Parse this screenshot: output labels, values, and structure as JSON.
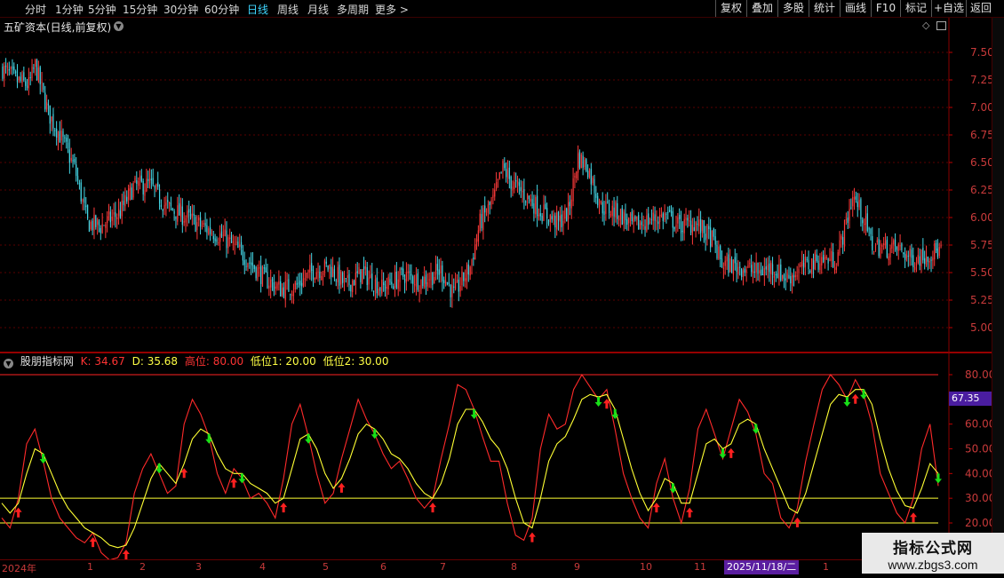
{
  "toolbar": {
    "timeframes": [
      {
        "label": "分时",
        "active": false
      },
      {
        "label": "1分钟",
        "active": false
      },
      {
        "label": "5分钟",
        "active": false
      },
      {
        "label": "15分钟",
        "active": false
      },
      {
        "label": "30分钟",
        "active": false
      },
      {
        "label": "60分钟",
        "active": false
      },
      {
        "label": "日线",
        "active": true
      },
      {
        "label": "周线",
        "active": false
      },
      {
        "label": "月线",
        "active": false
      },
      {
        "label": "多周期",
        "active": false
      },
      {
        "label": "更多",
        "active": false
      }
    ],
    "more_arrow": ">",
    "right_buttons": [
      "复权",
      "叠加",
      "多股",
      "统计",
      "画线",
      "F10",
      "标记",
      "+自选",
      "返回"
    ]
  },
  "stock": {
    "title": "五矿资本(日线,前复权)",
    "dropdown_icon": "chevron-down-icon"
  },
  "price_axis": {
    "ticks": [
      "7.50",
      "7.25",
      "7.00",
      "6.75",
      "6.50",
      "6.25",
      "6.00",
      "5.75",
      "5.50",
      "5.25",
      "5.00"
    ]
  },
  "indicator": {
    "name": "股朋指标网",
    "k_label": "K: 34.67",
    "d_label": "D: 35.68",
    "high_label": "高位: 80.00",
    "low1_label": "低位1: 20.00",
    "low2_label": "低位2: 30.00",
    "current_value": "67.35",
    "axis_ticks": [
      "80.00",
      "70.00",
      "60.00",
      "50.00",
      "40.00",
      "30.00",
      "20.00"
    ]
  },
  "date_axis": {
    "labels": [
      "2024年",
      "1",
      "2",
      "3",
      "4",
      "5",
      "6",
      "7",
      "8",
      "9",
      "10",
      "11",
      "1"
    ],
    "cursor_date": "2025/11/18/二"
  },
  "watermark": {
    "line1": "指标公式网",
    "line2": "www.zbgs3.com"
  },
  "colors": {
    "up": "#ff3b3b",
    "down": "#44d7e6",
    "k_line": "#ff2a2a",
    "d_line": "#ffff33",
    "ref_high": "#ff2222",
    "ref_low": "#ffff33",
    "grid": "#5a0000",
    "arrow_buy": "#ff2020",
    "arrow_sell": "#18e018"
  },
  "chart_data": [
    {
      "type": "candlestick",
      "title": "五矿资本(日线,前复权)",
      "yticks": [
        7.5,
        7.25,
        7.0,
        6.75,
        6.5,
        6.25,
        6.0,
        5.75,
        5.5,
        5.25,
        5.0
      ],
      "ylim": [
        4.95,
        7.65
      ],
      "anchors": [
        [
          0,
          7.35
        ],
        [
          8,
          7.25
        ],
        [
          16,
          7.2
        ],
        [
          20,
          7.38
        ],
        [
          28,
          6.95
        ],
        [
          36,
          6.72
        ],
        [
          44,
          6.45
        ],
        [
          52,
          5.95
        ],
        [
          60,
          5.92
        ],
        [
          72,
          6.05
        ],
        [
          80,
          6.28
        ],
        [
          90,
          6.3
        ],
        [
          100,
          6.1
        ],
        [
          110,
          6.02
        ],
        [
          122,
          5.92
        ],
        [
          135,
          5.82
        ],
        [
          148,
          5.65
        ],
        [
          160,
          5.45
        ],
        [
          170,
          5.35
        ],
        [
          180,
          5.38
        ],
        [
          190,
          5.52
        ],
        [
          200,
          5.55
        ],
        [
          210,
          5.38
        ],
        [
          220,
          5.5
        ],
        [
          232,
          5.36
        ],
        [
          246,
          5.48
        ],
        [
          256,
          5.42
        ],
        [
          268,
          5.52
        ],
        [
          276,
          5.3
        ],
        [
          286,
          5.55
        ],
        [
          292,
          5.95
        ],
        [
          300,
          6.15
        ],
        [
          306,
          6.45
        ],
        [
          312,
          6.3
        ],
        [
          320,
          6.2
        ],
        [
          330,
          6.05
        ],
        [
          340,
          5.95
        ],
        [
          346,
          6.05
        ],
        [
          352,
          6.55
        ],
        [
          358,
          6.45
        ],
        [
          366,
          6.1
        ],
        [
          376,
          6.05
        ],
        [
          386,
          5.92
        ],
        [
          396,
          5.98
        ],
        [
          406,
          6.02
        ],
        [
          414,
          5.92
        ],
        [
          424,
          5.95
        ],
        [
          434,
          5.8
        ],
        [
          440,
          5.58
        ],
        [
          452,
          5.55
        ],
        [
          462,
          5.5
        ],
        [
          470,
          5.55
        ],
        [
          480,
          5.45
        ],
        [
          490,
          5.55
        ],
        [
          500,
          5.62
        ],
        [
          510,
          5.62
        ],
        [
          516,
          5.95
        ],
        [
          520,
          6.2
        ],
        [
          526,
          6.02
        ],
        [
          532,
          5.75
        ],
        [
          540,
          5.72
        ],
        [
          548,
          5.72
        ],
        [
          556,
          5.62
        ],
        [
          564,
          5.66
        ],
        [
          572,
          5.7
        ]
      ],
      "note_units": "price"
    },
    {
      "type": "line",
      "series": [
        {
          "name": "K",
          "values": [
            22,
            18,
            30,
            52,
            58,
            45,
            30,
            22,
            18,
            14,
            12,
            16,
            8,
            5,
            6,
            12,
            32,
            42,
            48,
            40,
            32,
            35,
            60,
            70,
            64,
            55,
            40,
            32,
            42,
            38,
            30,
            32,
            28,
            22,
            38,
            60,
            68,
            55,
            40,
            28,
            32,
            46,
            58,
            70,
            62,
            56,
            48,
            42,
            45,
            38,
            30,
            26,
            30,
            46,
            60,
            76,
            74,
            66,
            55,
            45,
            45,
            28,
            15,
            13,
            22,
            50,
            64,
            58,
            60,
            74,
            80,
            75,
            70,
            74,
            58,
            40,
            30,
            22,
            18,
            36,
            46,
            30,
            20,
            34,
            58,
            66,
            56,
            46,
            58,
            70,
            65,
            56,
            40,
            36,
            22,
            18,
            26,
            45,
            60,
            74,
            80,
            76,
            70,
            78,
            72,
            60,
            40,
            32,
            24,
            20,
            30,
            50,
            60,
            35
          ]
        },
        {
          "name": "D",
          "values": [
            28,
            24,
            28,
            40,
            50,
            48,
            40,
            32,
            26,
            22,
            18,
            16,
            14,
            11,
            10,
            11,
            18,
            28,
            38,
            44,
            40,
            36,
            44,
            54,
            58,
            56,
            48,
            42,
            40,
            40,
            36,
            34,
            32,
            28,
            30,
            42,
            54,
            56,
            50,
            40,
            34,
            38,
            46,
            56,
            60,
            58,
            54,
            48,
            46,
            42,
            36,
            32,
            30,
            36,
            46,
            60,
            66,
            66,
            61,
            54,
            50,
            42,
            30,
            20,
            18,
            30,
            45,
            52,
            55,
            62,
            70,
            72,
            71,
            72,
            66,
            54,
            42,
            32,
            25,
            30,
            38,
            36,
            28,
            28,
            40,
            52,
            54,
            50,
            52,
            60,
            62,
            60,
            50,
            42,
            34,
            26,
            24,
            32,
            44,
            56,
            68,
            72,
            71,
            74,
            74,
            68,
            54,
            42,
            33,
            27,
            26,
            34,
            44,
            40
          ]
        }
      ],
      "reference_lines": {
        "高位": 80,
        "低位1": 20,
        "低位2": 30
      },
      "ylim": [
        8,
        86
      ],
      "yticks": [
        80,
        70,
        60,
        50,
        40,
        30,
        20
      ]
    }
  ]
}
